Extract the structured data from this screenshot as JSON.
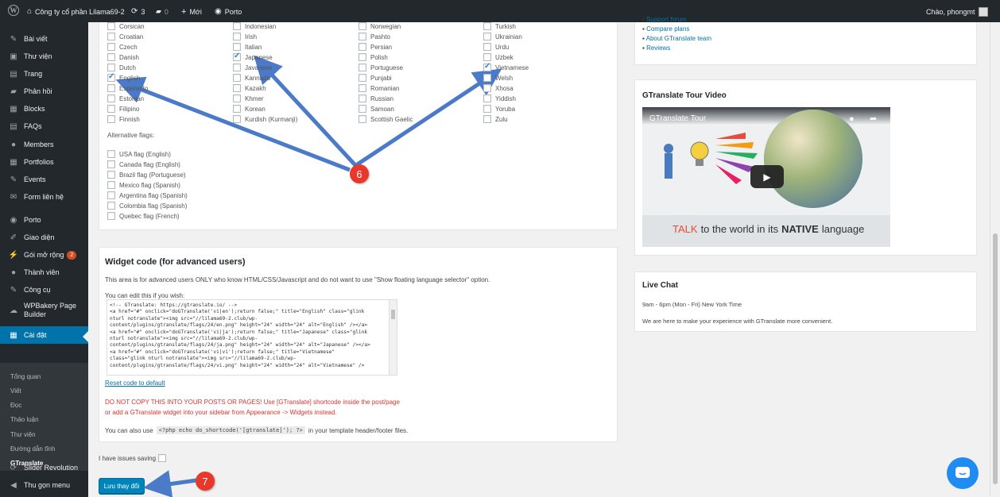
{
  "admin_bar": {
    "site_name": "Công ty cổ phần Lilama69-2",
    "updates_count": "3",
    "comments_count": "0",
    "new_label": "Mới",
    "theme_label": "Porto",
    "greeting": "Chào, phongmt"
  },
  "sidebar": {
    "items": [
      {
        "label": "Bài viết",
        "icon": "pin-icon"
      },
      {
        "label": "Thư viện",
        "icon": "media-icon"
      },
      {
        "label": "Trang",
        "icon": "page-icon"
      },
      {
        "label": "Phản hồi",
        "icon": "comment-icon"
      },
      {
        "label": "Blocks",
        "icon": "blocks-icon"
      },
      {
        "label": "FAQs",
        "icon": "faq-icon"
      },
      {
        "label": "Members",
        "icon": "members-icon"
      },
      {
        "label": "Portfolios",
        "icon": "portfolio-icon"
      },
      {
        "label": "Events",
        "icon": "pin-icon"
      },
      {
        "label": "Form liên hệ",
        "icon": "mail-icon"
      },
      {
        "label": "Porto",
        "icon": "porto-icon"
      },
      {
        "label": "Giao diện",
        "icon": "brush-icon"
      },
      {
        "label": "Gói mở rộng",
        "icon": "plugin-icon",
        "badge": "2"
      },
      {
        "label": "Thành viên",
        "icon": "user-icon"
      },
      {
        "label": "Công cụ",
        "icon": "wrench-icon"
      },
      {
        "label": "WPBakery Page Builder",
        "icon": "wpbakery-icon"
      },
      {
        "label": "Cài đặt",
        "icon": "settings-icon"
      },
      {
        "label": "Slider Revolution",
        "icon": "refresh-icon"
      },
      {
        "label": "Thu gọn menu",
        "icon": "collapse-icon"
      }
    ],
    "submenu": [
      "Tổng quan",
      "Viết",
      "Đọc",
      "Thảo luận",
      "Thư viện",
      "Đường dẫn tĩnh",
      "GTranslate"
    ]
  },
  "languages": {
    "col1": [
      {
        "label": "Corsican",
        "checked": false
      },
      {
        "label": "Croatian",
        "checked": false
      },
      {
        "label": "Czech",
        "checked": false
      },
      {
        "label": "Danish",
        "checked": false
      },
      {
        "label": "Dutch",
        "checked": false
      },
      {
        "label": "English",
        "checked": true
      },
      {
        "label": "Esperanto",
        "checked": false
      },
      {
        "label": "Estonian",
        "checked": false
      },
      {
        "label": "Filipino",
        "checked": false
      },
      {
        "label": "Finnish",
        "checked": false
      }
    ],
    "col2": [
      {
        "label": "Indonesian",
        "checked": false
      },
      {
        "label": "Irish",
        "checked": false
      },
      {
        "label": "Italian",
        "checked": false
      },
      {
        "label": "Japanese",
        "checked": true
      },
      {
        "label": "Javanese",
        "checked": false
      },
      {
        "label": "Kannada",
        "checked": false
      },
      {
        "label": "Kazakh",
        "checked": false
      },
      {
        "label": "Khmer",
        "checked": false
      },
      {
        "label": "Korean",
        "checked": false
      },
      {
        "label": "Kurdish (Kurmanji)",
        "checked": false
      }
    ],
    "col3": [
      {
        "label": "Norwegian",
        "checked": false
      },
      {
        "label": "Pashto",
        "checked": false
      },
      {
        "label": "Persian",
        "checked": false
      },
      {
        "label": "Polish",
        "checked": false
      },
      {
        "label": "Portuguese",
        "checked": false
      },
      {
        "label": "Punjabi",
        "checked": false
      },
      {
        "label": "Romanian",
        "checked": false
      },
      {
        "label": "Russian",
        "checked": false
      },
      {
        "label": "Samoan",
        "checked": false
      },
      {
        "label": "Scottish Gaelic",
        "checked": false
      }
    ],
    "col4": [
      {
        "label": "Turkish",
        "checked": false
      },
      {
        "label": "Ukrainian",
        "checked": false
      },
      {
        "label": "Urdu",
        "checked": false
      },
      {
        "label": "Uzbek",
        "checked": false
      },
      {
        "label": "Vietnamese",
        "checked": true
      },
      {
        "label": "Welsh",
        "checked": false
      },
      {
        "label": "Xhosa",
        "checked": false
      },
      {
        "label": "Yiddish",
        "checked": false
      },
      {
        "label": "Yoruba",
        "checked": false
      },
      {
        "label": "Zulu",
        "checked": false
      }
    ],
    "alt_flags_label": "Alternative flags:",
    "alt_flags": [
      "USA flag (English)",
      "Canada flag (English)",
      "Brazil flag (Portuguese)",
      "Mexico flag (Spanish)",
      "Argentina flag (Spanish)",
      "Colombia flag (Spanish)",
      "Quebec flag (French)"
    ]
  },
  "widget_code": {
    "title": "Widget code (for advanced users)",
    "description": "This area is for advanced users ONLY who know HTML/CSS/Javascript and do not want to use \"Show floating language selector\" option.",
    "edit_label": "You can edit this if you wish:",
    "code_lines": [
      "<!-- GTranslate: https://gtranslate.io/ -->",
      "<a href=\"#\" onclick=\"doGTranslate('vi|en');return false;\" title=\"English\" class=\"glink",
      "nturl notranslate\"><img src=\"//lilama69-2.club/wp-",
      "content/plugins/gtranslate/flags/24/en.png\" height=\"24\" width=\"24\" alt=\"English\" /></a>",
      "<a href=\"#\" onclick=\"doGTranslate('vi|ja');return false;\" title=\"Japanese\" class=\"glink",
      "nturl notranslate\"><img src=\"//lilama69-2.club/wp-",
      "content/plugins/gtranslate/flags/24/ja.png\" height=\"24\" width=\"24\" alt=\"Japanese\" /></a>",
      "<a href=\"#\" onclick=\"doGTranslate('vi|vi');return false;\" title=\"Vietnamese\"",
      "class=\"glink nturl notranslate\"><img src=\"//lilama69-2.club/wp-",
      "content/plugins/gtranslate/flags/24/vi.png\" height=\"24\" width=\"24\" alt=\"Vietnamese\" />"
    ],
    "reset_link": "Reset code to default",
    "warning_line1": "DO NOT COPY THIS INTO YOUR POSTS OR PAGES! Use [GTranslate] shortcode inside the post/page",
    "warning_line2": "or add a GTranslate widget into your sidebar from Appearance -> Widgets instead.",
    "php_prefix": "You can also use",
    "php_code": "<?php echo do_shortcode('[gtranslate]'); ?>",
    "php_suffix": "in your template header/footer files."
  },
  "issues_label": "I have issues saving",
  "save_button": "Lưu thay đổi",
  "right_sidebar": {
    "links": [
      "Support forum",
      "Compare plans",
      "About GTranslate team",
      "Reviews"
    ],
    "tour_title": "GTranslate Tour Video",
    "video_title": "GTranslate Tour",
    "video_tagline_1": "TALK",
    "video_tagline_2": "to the world in its",
    "video_tagline_3": "NATIVE",
    "video_tagline_4": "language",
    "chat_title": "Live Chat",
    "chat_hours": "9am - 6pm (Mon - Fri) New York Time",
    "chat_text": "We are here to make your experience with GTranslate more convenient."
  },
  "annotations": {
    "marker_6": "6",
    "marker_7": "7"
  },
  "colors": {
    "admin_dark": "#23282d",
    "accent": "#0073aa",
    "button": "#0085ba",
    "warning": "#dc3232",
    "marker": "#e8382c",
    "arrow": "#4a7ac8"
  }
}
